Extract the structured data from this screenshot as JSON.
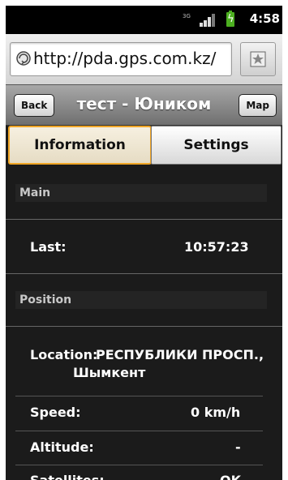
{
  "status_bar": {
    "network": "3G",
    "time": "4:58"
  },
  "browser": {
    "url": "http://pda.gps.com.kz/"
  },
  "header": {
    "back_label": "Back",
    "title": "тест - Юником",
    "map_label": "Map"
  },
  "tabs": [
    {
      "label": "Information",
      "active": true
    },
    {
      "label": "Settings",
      "active": false
    }
  ],
  "sections": {
    "main": {
      "title": "Main",
      "last_label": "Last:",
      "last_value": "10:57:23"
    },
    "position": {
      "title": "Position",
      "location_label": "Location:",
      "location_value_line1": "РЕСПУБЛИКИ ПРОСП.,",
      "location_value_line2": "Шымкент",
      "speed_label": "Speed:",
      "speed_value": "0 km/h",
      "altitude_label": "Altitude:",
      "altitude_value": "-",
      "satellites_label": "Satellites:",
      "satellites_value": "OK"
    }
  },
  "colors": {
    "active_tab_border": "#f0a626",
    "battery": "#4caf20",
    "page_background": "#1b1b1b"
  }
}
